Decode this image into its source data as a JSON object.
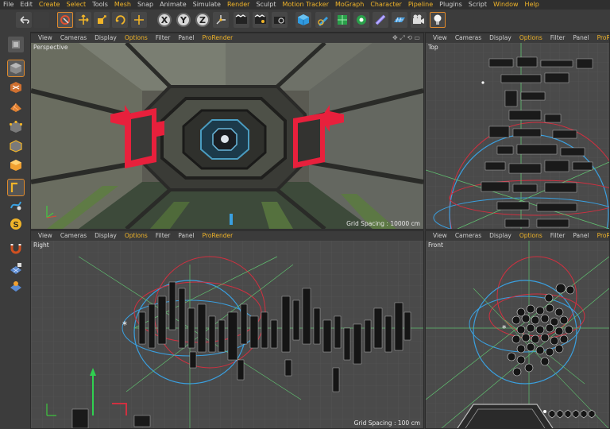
{
  "menubar": {
    "items": [
      {
        "label": "File",
        "highlight": false
      },
      {
        "label": "Edit",
        "highlight": false
      },
      {
        "label": "Create",
        "highlight": true
      },
      {
        "label": "Select",
        "highlight": true
      },
      {
        "label": "Tools",
        "highlight": false
      },
      {
        "label": "Mesh",
        "highlight": true
      },
      {
        "label": "Snap",
        "highlight": false
      },
      {
        "label": "Animate",
        "highlight": false
      },
      {
        "label": "Simulate",
        "highlight": false
      },
      {
        "label": "Render",
        "highlight": true
      },
      {
        "label": "Sculpt",
        "highlight": false
      },
      {
        "label": "Motion Tracker",
        "highlight": true
      },
      {
        "label": "MoGraph",
        "highlight": true
      },
      {
        "label": "Character",
        "highlight": true
      },
      {
        "label": "Pipeline",
        "highlight": true
      },
      {
        "label": "Plugins",
        "highlight": false
      },
      {
        "label": "Script",
        "highlight": false
      },
      {
        "label": "Window",
        "highlight": true
      },
      {
        "label": "Help",
        "highlight": true
      }
    ]
  },
  "toolbar": {
    "axis": {
      "x": "X",
      "y": "Y",
      "z": "Z"
    },
    "icons": [
      "undo-icon",
      "redo-icon",
      "live-selection-icon",
      "move-icon",
      "scale-icon",
      "rotate-icon",
      "coordinate-system-icon",
      "render-view-icon",
      "render-to-picture-viewer-icon",
      "edit-render-settings-icon",
      "cube-icon",
      "pen-icon",
      "subdivision-icon",
      "array-icon",
      "deformer-icon",
      "floor-icon",
      "camera-icon",
      "light-icon"
    ]
  },
  "viewports": {
    "perspective": {
      "title": "Perspective",
      "grid": "Grid Spacing : 10000 cm",
      "menu": [
        "View",
        "Cameras",
        "Display",
        "Options",
        "Filter",
        "Panel",
        "ProRender"
      ]
    },
    "top": {
      "title": "Top",
      "grid": "",
      "menu": [
        "View",
        "Cameras",
        "Display",
        "Options",
        "Filter",
        "Panel",
        "ProRender"
      ]
    },
    "right": {
      "title": "Right",
      "grid": "Grid Spacing : 100 cm",
      "menu": [
        "View",
        "Cameras",
        "Display",
        "Options",
        "Filter",
        "Panel",
        "ProRender"
      ]
    },
    "front": {
      "title": "Front",
      "grid": "",
      "menu": [
        "View",
        "Cameras",
        "Display",
        "Options",
        "Filter",
        "Panel",
        "ProRender"
      ]
    }
  },
  "colors": {
    "accent": "#f0b429",
    "selection_outline": "#e08a2c",
    "light_gizmo_blue": "#3aa0e0",
    "light_gizmo_red": "#d03040",
    "model_red": "#e8203c"
  }
}
